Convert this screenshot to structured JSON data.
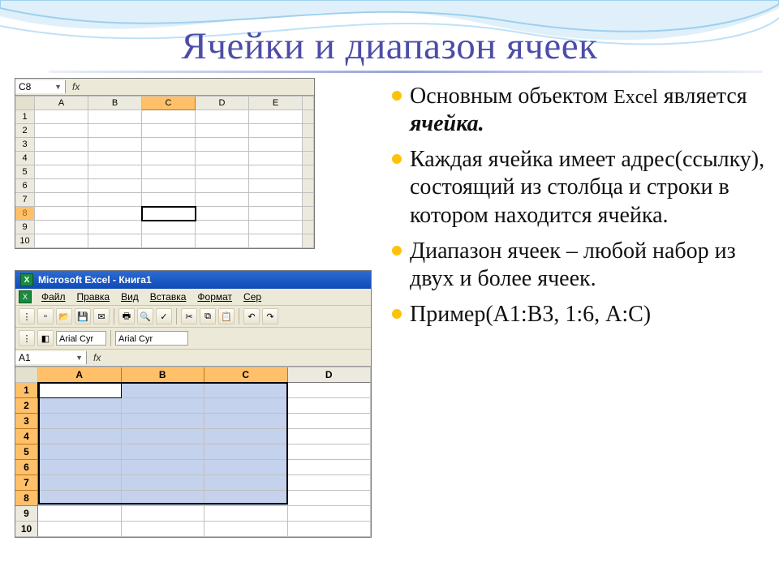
{
  "title": "Ячейки и диапазон ячеек",
  "bullets": {
    "b1a": "Основным объектом ",
    "b1b": "Excel",
    "b1c": " является ",
    "b1d": "ячейка.",
    "b2": "Каждая ячейка имеет адрес(ссылку), состоящий из столбца и строки в котором находится ячейка.",
    "b3": "Диапазон ячеек – любой набор из двух и более ячеек.",
    "b4": "Пример(А1:В3, 1:6, А:С)"
  },
  "ss1": {
    "namebox": "C8",
    "fx": "fx",
    "cols": [
      "A",
      "B",
      "C",
      "D",
      "E"
    ],
    "rows": [
      "1",
      "2",
      "3",
      "4",
      "5",
      "6",
      "7",
      "8",
      "9",
      "10"
    ],
    "active": {
      "row": 8,
      "col": "C"
    },
    "sel_col": "C",
    "sel_row": "8"
  },
  "ss2": {
    "window_title": "Microsoft Excel - Книга1",
    "menu": {
      "file": "Файл",
      "edit": "Правка",
      "view": "Вид",
      "insert": "Вставка",
      "format": "Формат",
      "service": "Сер"
    },
    "font": "Arial Cyr",
    "toolbar_icons": [
      "new",
      "open",
      "save",
      "mail",
      "print",
      "preview",
      "spell",
      "cut",
      "copy",
      "paste",
      "undo",
      "redo"
    ],
    "namebox": "A1",
    "fx": "fx",
    "cols": [
      "A",
      "B",
      "C",
      "D"
    ],
    "rows": [
      "1",
      "2",
      "3",
      "4",
      "5",
      "6",
      "7",
      "8",
      "9",
      "10"
    ],
    "sel_range": {
      "r1": 1,
      "c1": 1,
      "r2": 8,
      "c2": 3
    }
  }
}
